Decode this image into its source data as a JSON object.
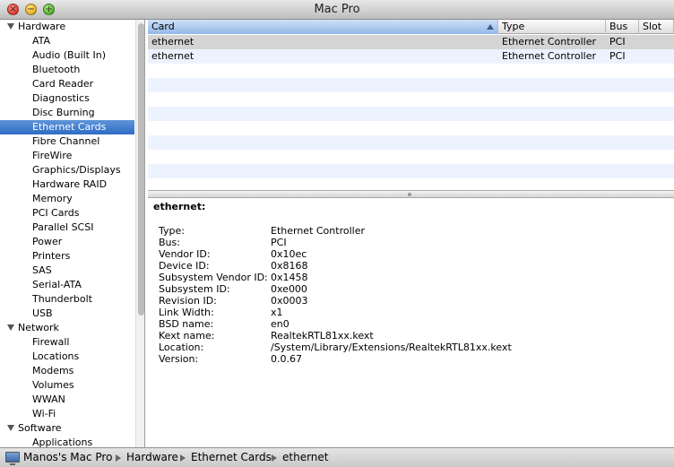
{
  "window": {
    "title": "Mac Pro"
  },
  "sidebar": {
    "rows": [
      {
        "label": "Hardware",
        "type": "group",
        "name": "sidebar-group-hardware"
      },
      {
        "label": "ATA",
        "type": "item",
        "name": "sidebar-item-ata"
      },
      {
        "label": "Audio (Built In)",
        "type": "item",
        "name": "sidebar-item-audio"
      },
      {
        "label": "Bluetooth",
        "type": "item",
        "name": "sidebar-item-bluetooth"
      },
      {
        "label": "Card Reader",
        "type": "item",
        "name": "sidebar-item-card-reader"
      },
      {
        "label": "Diagnostics",
        "type": "item",
        "name": "sidebar-item-diagnostics"
      },
      {
        "label": "Disc Burning",
        "type": "item",
        "name": "sidebar-item-disc-burning"
      },
      {
        "label": "Ethernet Cards",
        "type": "item",
        "name": "sidebar-item-ethernet-cards",
        "selected": true
      },
      {
        "label": "Fibre Channel",
        "type": "item",
        "name": "sidebar-item-fibre-channel"
      },
      {
        "label": "FireWire",
        "type": "item",
        "name": "sidebar-item-firewire"
      },
      {
        "label": "Graphics/Displays",
        "type": "item",
        "name": "sidebar-item-graphics-displays"
      },
      {
        "label": "Hardware RAID",
        "type": "item",
        "name": "sidebar-item-hardware-raid"
      },
      {
        "label": "Memory",
        "type": "item",
        "name": "sidebar-item-memory"
      },
      {
        "label": "PCI Cards",
        "type": "item",
        "name": "sidebar-item-pci-cards"
      },
      {
        "label": "Parallel SCSI",
        "type": "item",
        "name": "sidebar-item-parallel-scsi"
      },
      {
        "label": "Power",
        "type": "item",
        "name": "sidebar-item-power"
      },
      {
        "label": "Printers",
        "type": "item",
        "name": "sidebar-item-printers"
      },
      {
        "label": "SAS",
        "type": "item",
        "name": "sidebar-item-sas"
      },
      {
        "label": "Serial-ATA",
        "type": "item",
        "name": "sidebar-item-serial-ata"
      },
      {
        "label": "Thunderbolt",
        "type": "item",
        "name": "sidebar-item-thunderbolt"
      },
      {
        "label": "USB",
        "type": "item",
        "name": "sidebar-item-usb"
      },
      {
        "label": "Network",
        "type": "group",
        "name": "sidebar-group-network"
      },
      {
        "label": "Firewall",
        "type": "item",
        "name": "sidebar-item-firewall"
      },
      {
        "label": "Locations",
        "type": "item",
        "name": "sidebar-item-locations"
      },
      {
        "label": "Modems",
        "type": "item",
        "name": "sidebar-item-modems"
      },
      {
        "label": "Volumes",
        "type": "item",
        "name": "sidebar-item-volumes"
      },
      {
        "label": "WWAN",
        "type": "item",
        "name": "sidebar-item-wwan"
      },
      {
        "label": "Wi-Fi",
        "type": "item",
        "name": "sidebar-item-wi-fi"
      },
      {
        "label": "Software",
        "type": "group",
        "name": "sidebar-group-software"
      },
      {
        "label": "Applications",
        "type": "item",
        "name": "sidebar-item-applications"
      }
    ]
  },
  "table": {
    "columns": [
      {
        "label": "Card",
        "sorted": true
      },
      {
        "label": "Type"
      },
      {
        "label": "Bus"
      },
      {
        "label": "Slot"
      }
    ],
    "rows": [
      {
        "card": "ethernet",
        "type": "Ethernet Controller",
        "bus": "PCI",
        "slot": "",
        "selected": true
      },
      {
        "card": "ethernet",
        "type": "Ethernet Controller",
        "bus": "PCI",
        "slot": ""
      }
    ]
  },
  "detail": {
    "title": "ethernet:",
    "properties": [
      {
        "label": "Type:",
        "value": "Ethernet Controller"
      },
      {
        "label": "Bus:",
        "value": "PCI"
      },
      {
        "label": "Vendor ID:",
        "value": "0x10ec"
      },
      {
        "label": "Device ID:",
        "value": "0x8168"
      },
      {
        "label": "Subsystem Vendor ID:",
        "value": "0x1458"
      },
      {
        "label": "Subsystem ID:",
        "value": "0xe000"
      },
      {
        "label": "Revision ID:",
        "value": "0x0003"
      },
      {
        "label": "Link Width:",
        "value": "x1"
      },
      {
        "label": "BSD name:",
        "value": "en0"
      },
      {
        "label": "Kext name:",
        "value": "RealtekRTL81xx.kext"
      },
      {
        "label": "Location:",
        "value": "/System/Library/Extensions/RealtekRTL81xx.kext"
      },
      {
        "label": "Version:",
        "value": "0.0.67"
      }
    ]
  },
  "pathbar": {
    "crumbs": [
      "Manos's Mac Pro",
      "Hardware",
      "Ethernet Cards",
      "ethernet"
    ]
  }
}
